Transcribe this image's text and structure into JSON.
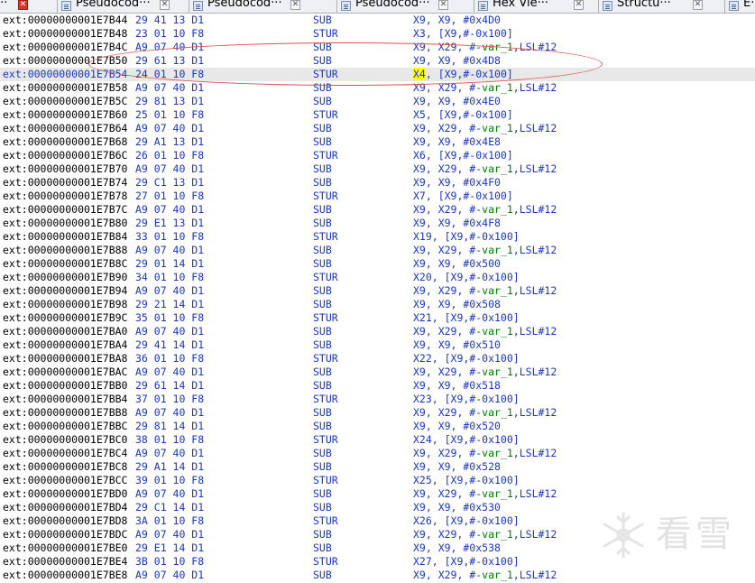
{
  "tabs": [
    {
      "label": "e···",
      "active": true
    },
    {
      "label": "Pseudocod···",
      "active": false
    },
    {
      "label": "Pseudocod···",
      "active": false
    },
    {
      "label": "Pseudocod···",
      "active": false
    },
    {
      "label": "Hex Vie···",
      "active": false
    },
    {
      "label": "Structu···",
      "active": false
    },
    {
      "label": "E···",
      "active": false
    }
  ],
  "tab_close_glyph": "✕",
  "rows": [
    {
      "addr": "ext:00000000001E7B44",
      "bytes": "29 41 13 D1",
      "mnem": "SUB",
      "ops": [
        "X9, X9, #0x4D0"
      ]
    },
    {
      "addr": "ext:00000000001E7B48",
      "bytes": "23 01 10 F8",
      "mnem": "STUR",
      "ops": [
        "X3, [X9,#-0x100]"
      ]
    },
    {
      "addr": "ext:00000000001E7B4C",
      "bytes": "A9 07 40 D1",
      "mnem": "SUB",
      "ops": [
        "X9, X29, #",
        "var_1",
        ",LSL#12"
      ]
    },
    {
      "addr": "ext:00000000001E7B50",
      "bytes": "29 61 13 D1",
      "mnem": "SUB",
      "ops": [
        "X9, X9, #0x4D8"
      ]
    },
    {
      "addr": "ext:00000000001E7B54",
      "bytes": "24 01 10 F8",
      "mnem": "STUR",
      "ops": [
        "X4",
        ", [X9,#-0x100]"
      ],
      "selected": true
    },
    {
      "addr": "ext:00000000001E7B58",
      "bytes": "A9 07 40 D1",
      "mnem": "SUB",
      "ops": [
        "X9, X29, #",
        "var_1",
        ",LSL#12"
      ]
    },
    {
      "addr": "ext:00000000001E7B5C",
      "bytes": "29 81 13 D1",
      "mnem": "SUB",
      "ops": [
        "X9, X9, #0x4E0"
      ]
    },
    {
      "addr": "ext:00000000001E7B60",
      "bytes": "25 01 10 F8",
      "mnem": "STUR",
      "ops": [
        "X5, [X9,#-0x100]"
      ]
    },
    {
      "addr": "ext:00000000001E7B64",
      "bytes": "A9 07 40 D1",
      "mnem": "SUB",
      "ops": [
        "X9, X29, #",
        "var_1",
        ",LSL#12"
      ]
    },
    {
      "addr": "ext:00000000001E7B68",
      "bytes": "29 A1 13 D1",
      "mnem": "SUB",
      "ops": [
        "X9, X9, #0x4E8"
      ]
    },
    {
      "addr": "ext:00000000001E7B6C",
      "bytes": "26 01 10 F8",
      "mnem": "STUR",
      "ops": [
        "X6, [X9,#-0x100]"
      ]
    },
    {
      "addr": "ext:00000000001E7B70",
      "bytes": "A9 07 40 D1",
      "mnem": "SUB",
      "ops": [
        "X9, X29, #",
        "var_1",
        ",LSL#12"
      ]
    },
    {
      "addr": "ext:00000000001E7B74",
      "bytes": "29 C1 13 D1",
      "mnem": "SUB",
      "ops": [
        "X9, X9, #0x4F0"
      ]
    },
    {
      "addr": "ext:00000000001E7B78",
      "bytes": "27 01 10 F8",
      "mnem": "STUR",
      "ops": [
        "X7, [X9,#-0x100]"
      ]
    },
    {
      "addr": "ext:00000000001E7B7C",
      "bytes": "A9 07 40 D1",
      "mnem": "SUB",
      "ops": [
        "X9, X29, #",
        "var_1",
        ",LSL#12"
      ]
    },
    {
      "addr": "ext:00000000001E7B80",
      "bytes": "29 E1 13 D1",
      "mnem": "SUB",
      "ops": [
        "X9, X9, #0x4F8"
      ]
    },
    {
      "addr": "ext:00000000001E7B84",
      "bytes": "33 01 10 F8",
      "mnem": "STUR",
      "ops": [
        "X19, [X9,#-0x100]"
      ]
    },
    {
      "addr": "ext:00000000001E7B88",
      "bytes": "A9 07 40 D1",
      "mnem": "SUB",
      "ops": [
        "X9, X29, #",
        "var_1",
        ",LSL#12"
      ]
    },
    {
      "addr": "ext:00000000001E7B8C",
      "bytes": "29 01 14 D1",
      "mnem": "SUB",
      "ops": [
        "X9, X9, #0x500"
      ]
    },
    {
      "addr": "ext:00000000001E7B90",
      "bytes": "34 01 10 F8",
      "mnem": "STUR",
      "ops": [
        "X20, [X9,#-0x100]"
      ]
    },
    {
      "addr": "ext:00000000001E7B94",
      "bytes": "A9 07 40 D1",
      "mnem": "SUB",
      "ops": [
        "X9, X29, #",
        "var_1",
        ",LSL#12"
      ]
    },
    {
      "addr": "ext:00000000001E7B98",
      "bytes": "29 21 14 D1",
      "mnem": "SUB",
      "ops": [
        "X9, X9, #0x508"
      ]
    },
    {
      "addr": "ext:00000000001E7B9C",
      "bytes": "35 01 10 F8",
      "mnem": "STUR",
      "ops": [
        "X21, [X9,#-0x100]"
      ]
    },
    {
      "addr": "ext:00000000001E7BA0",
      "bytes": "A9 07 40 D1",
      "mnem": "SUB",
      "ops": [
        "X9, X29, #",
        "var_1",
        ",LSL#12"
      ]
    },
    {
      "addr": "ext:00000000001E7BA4",
      "bytes": "29 41 14 D1",
      "mnem": "SUB",
      "ops": [
        "X9, X9, #0x510"
      ]
    },
    {
      "addr": "ext:00000000001E7BA8",
      "bytes": "36 01 10 F8",
      "mnem": "STUR",
      "ops": [
        "X22, [X9,#-0x100]"
      ]
    },
    {
      "addr": "ext:00000000001E7BAC",
      "bytes": "A9 07 40 D1",
      "mnem": "SUB",
      "ops": [
        "X9, X29, #",
        "var_1",
        ",LSL#12"
      ]
    },
    {
      "addr": "ext:00000000001E7BB0",
      "bytes": "29 61 14 D1",
      "mnem": "SUB",
      "ops": [
        "X9, X9, #0x518"
      ]
    },
    {
      "addr": "ext:00000000001E7BB4",
      "bytes": "37 01 10 F8",
      "mnem": "STUR",
      "ops": [
        "X23, [X9,#-0x100]"
      ]
    },
    {
      "addr": "ext:00000000001E7BB8",
      "bytes": "A9 07 40 D1",
      "mnem": "SUB",
      "ops": [
        "X9, X29, #",
        "var_1",
        ",LSL#12"
      ]
    },
    {
      "addr": "ext:00000000001E7BBC",
      "bytes": "29 81 14 D1",
      "mnem": "SUB",
      "ops": [
        "X9, X9, #0x520"
      ]
    },
    {
      "addr": "ext:00000000001E7BC0",
      "bytes": "38 01 10 F8",
      "mnem": "STUR",
      "ops": [
        "X24, [X9,#-0x100]"
      ]
    },
    {
      "addr": "ext:00000000001E7BC4",
      "bytes": "A9 07 40 D1",
      "mnem": "SUB",
      "ops": [
        "X9, X29, #",
        "var_1",
        ",LSL#12"
      ]
    },
    {
      "addr": "ext:00000000001E7BC8",
      "bytes": "29 A1 14 D1",
      "mnem": "SUB",
      "ops": [
        "X9, X9, #0x528"
      ]
    },
    {
      "addr": "ext:00000000001E7BCC",
      "bytes": "39 01 10 F8",
      "mnem": "STUR",
      "ops": [
        "X25, [X9,#-0x100]"
      ]
    },
    {
      "addr": "ext:00000000001E7BD0",
      "bytes": "A9 07 40 D1",
      "mnem": "SUB",
      "ops": [
        "X9, X29, #",
        "var_1",
        ",LSL#12"
      ]
    },
    {
      "addr": "ext:00000000001E7BD4",
      "bytes": "29 C1 14 D1",
      "mnem": "SUB",
      "ops": [
        "X9, X9, #0x530"
      ]
    },
    {
      "addr": "ext:00000000001E7BD8",
      "bytes": "3A 01 10 F8",
      "mnem": "STUR",
      "ops": [
        "X26, [X9,#-0x100]"
      ]
    },
    {
      "addr": "ext:00000000001E7BDC",
      "bytes": "A9 07 40 D1",
      "mnem": "SUB",
      "ops": [
        "X9, X29, #",
        "var_1",
        ",LSL#12"
      ]
    },
    {
      "addr": "ext:00000000001E7BE0",
      "bytes": "29 E1 14 D1",
      "mnem": "SUB",
      "ops": [
        "X9, X9, #0x538"
      ]
    },
    {
      "addr": "ext:00000000001E7BE4",
      "bytes": "3B 01 10 F8",
      "mnem": "STUR",
      "ops": [
        "X27, [X9,#-0x100]"
      ]
    },
    {
      "addr": "ext:00000000001E7BE8",
      "bytes": "A9 07 40 D1",
      "mnem": "SUB",
      "ops": [
        "X9, X29, #",
        "var_1",
        ",LSL#12"
      ]
    }
  ],
  "watermark": {
    "text": "看雪",
    "icon": "snowflake-icon"
  },
  "colors": {
    "code": "#1a35c8",
    "symbol": "#008000",
    "highlight": "#ffff00",
    "selection": "#e8e8e8",
    "annotation": "#e25050"
  }
}
